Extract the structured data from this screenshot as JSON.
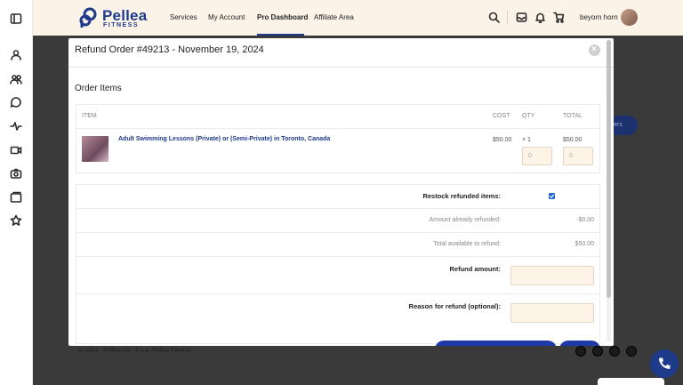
{
  "header": {
    "brand_name": "Pellea",
    "brand_sub": "FITNESS",
    "nav": [
      "Services",
      "My Account",
      "Pro Dashboard",
      "Affiliate Area"
    ],
    "active_nav": "Pro Dashboard",
    "username": "beyorn horn"
  },
  "sidebar_icons": [
    "panel-toggle-icon",
    "users-icon",
    "group-icon",
    "chat-icon",
    "activity-icon",
    "video-icon",
    "camera-icon",
    "folder-icon",
    "star-icon"
  ],
  "background": {
    "pill_text": "ers",
    "footer": "© 2024 - Pellea Inc. d.b.a. Pellea Fitness"
  },
  "modal": {
    "title": "Refund Order #49213 - November 19, 2024",
    "close_glyph": "×",
    "section_title": "Order Items",
    "columns": {
      "item": "ITEM",
      "cost": "COST",
      "qty": "QTY",
      "total": "TOTAL"
    },
    "item": {
      "name": "Adult Swimming Lessons (Private) or (Semi-Private) in Toronto, Canada",
      "cost": "$50.00",
      "qty": "× 1",
      "total": "$50.00",
      "refund_qty_placeholder": "0",
      "refund_total_placeholder": "0"
    },
    "restock_label": "Restock refunded items:",
    "restock_checked": true,
    "already_refunded_label": "Amount already refunded:",
    "already_refunded_value": "-$0.00",
    "available_label": "Total available to refund:",
    "available_value": "$50.00",
    "refund_amount_label": "Refund amount:",
    "reason_label": "Reason for refund (optional):"
  },
  "colors": {
    "brand": "#1e3a8a",
    "header_bg": "#fbf3e8",
    "input_bg": "#fdf3e6",
    "checkbox": "#1e6bd6"
  }
}
